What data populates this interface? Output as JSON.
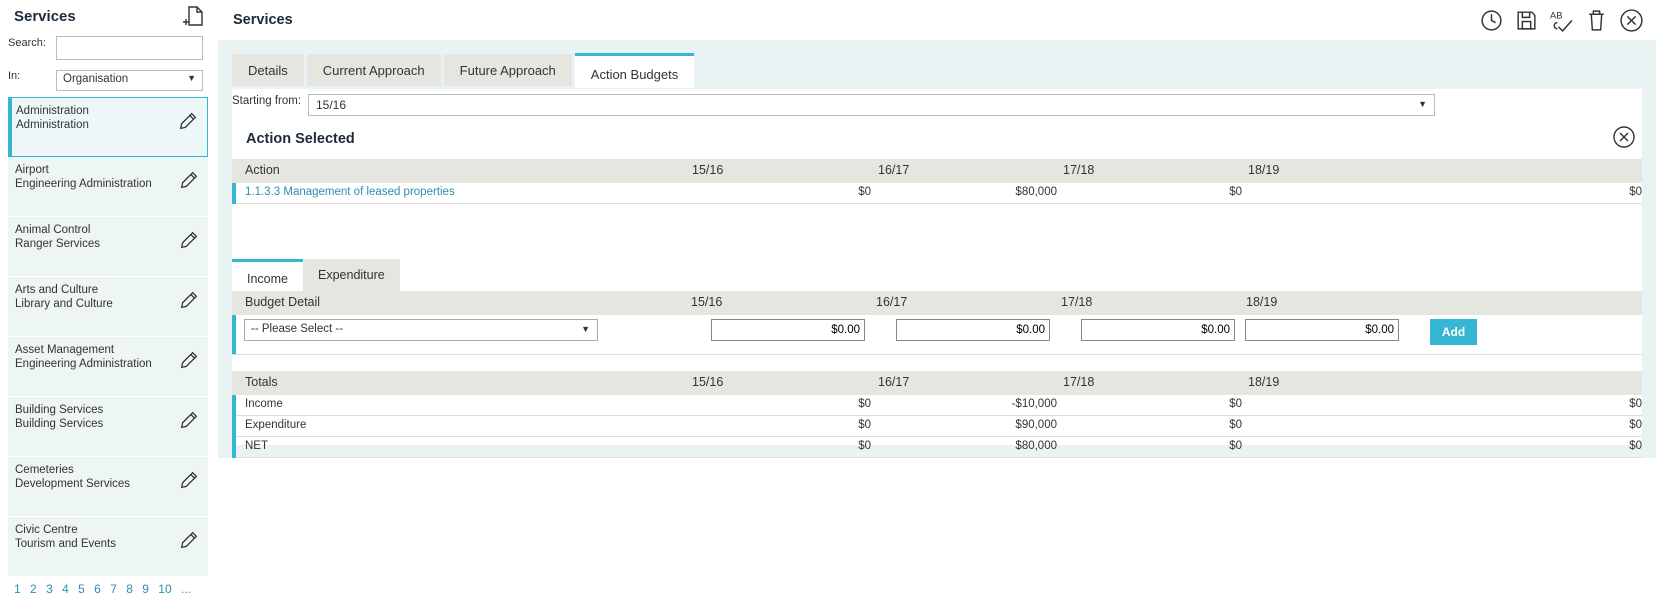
{
  "sidebar": {
    "title": "Services",
    "search_label": "Search:",
    "search_value": "",
    "in_label": "In:",
    "in_selected": "Organisation",
    "items": [
      {
        "line1": "Administration",
        "line2": "Administration"
      },
      {
        "line1": "Airport",
        "line2": "Engineering Administration"
      },
      {
        "line1": "Animal Control",
        "line2": "Ranger Services"
      },
      {
        "line1": "Arts and Culture",
        "line2": "Library and Culture"
      },
      {
        "line1": "Asset Management",
        "line2": "Engineering Administration"
      },
      {
        "line1": "Building Services",
        "line2": "Building Services"
      },
      {
        "line1": "Cemeteries",
        "line2": "Development Services"
      },
      {
        "line1": "Civic Centre",
        "line2": "Tourism and Events"
      }
    ],
    "pages": [
      "1",
      "2",
      "3",
      "4",
      "5",
      "6",
      "7",
      "8",
      "9",
      "10",
      "..."
    ]
  },
  "header": {
    "title": "Services",
    "spellcheck_glyph": "AB"
  },
  "tabs": [
    "Details",
    "Current Approach",
    "Future Approach",
    "Action Budgets"
  ],
  "starting_from": {
    "label": "Starting from:",
    "value": "15/16"
  },
  "action_section": {
    "title": "Action Selected",
    "header": [
      "Action",
      "15/16",
      "16/17",
      "17/18",
      "18/19"
    ],
    "row": {
      "name": "1.1.3.3 Management of leased properties",
      "values": [
        "$0",
        "$80,000",
        "$0",
        "$0"
      ]
    }
  },
  "subtabs": [
    "Income",
    "Expenditure"
  ],
  "budget_detail": {
    "header": [
      "Budget Detail",
      "15/16",
      "16/17",
      "17/18",
      "18/19"
    ],
    "select_placeholder": "-- Please Select --",
    "inputs": [
      "$0.00",
      "$0.00",
      "$0.00",
      "$0.00"
    ],
    "add_label": "Add"
  },
  "totals": {
    "header": [
      "Totals",
      "15/16",
      "16/17",
      "17/18",
      "18/19"
    ],
    "rows": [
      {
        "label": "Income",
        "values": [
          "$0",
          "-$10,000",
          "$0",
          "$0"
        ]
      },
      {
        "label": "Expenditure",
        "values": [
          "$0",
          "$90,000",
          "$0",
          "$0"
        ]
      },
      {
        "label": "NET",
        "values": [
          "$0",
          "$80,000",
          "$0",
          "$0"
        ]
      }
    ]
  },
  "colors": {
    "accent": "#35b6d2",
    "panel_bg": "#eaf3f3",
    "header_bg": "#e6e6e1",
    "link": "#2a8fb0"
  }
}
